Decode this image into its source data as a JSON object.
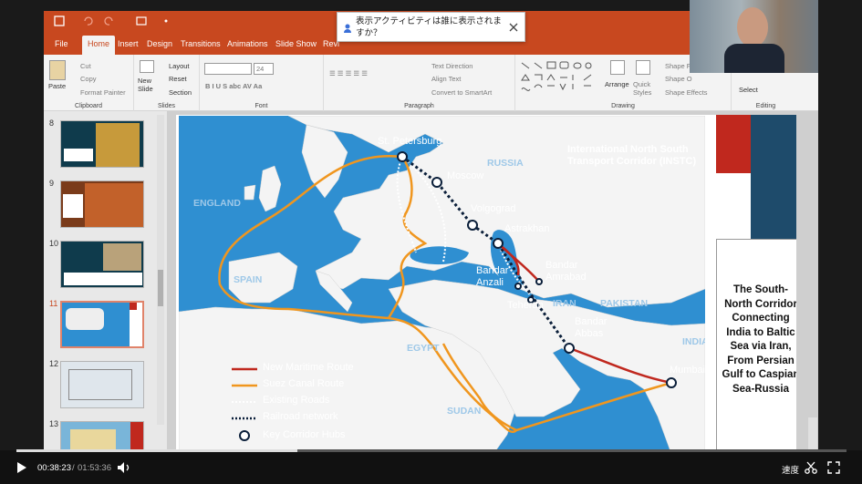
{
  "notification": {
    "text": "表示アクティビティは誰に表示されますか？"
  },
  "ribbon_tabs": [
    "File",
    "Home",
    "Insert",
    "Design",
    "Transitions",
    "Animations",
    "Slide Show",
    "Revi"
  ],
  "ribbon": {
    "clipboard": {
      "paste": "Paste",
      "cut": "Cut",
      "copy": "Copy",
      "format_painter": "Format Painter",
      "label": "Clipboard"
    },
    "slides": {
      "new_slide": "New Slide",
      "layout": "Layout",
      "reset": "Reset",
      "section": "Section",
      "label": "Slides"
    },
    "font": {
      "size": "24",
      "label": "Font"
    },
    "paragraph": {
      "text_direction": "Text Direction",
      "align_text": "Align Text",
      "convert_smartart": "Convert to SmartArt",
      "label": "Paragraph"
    },
    "drawing": {
      "arrange": "Arrange",
      "quick_styles": "Quick Styles",
      "shape_fill": "Shape F",
      "shape_outline": "Shape O",
      "shape_effects": "Shape Effects",
      "label": "Drawing"
    },
    "editing": {
      "select": "Select",
      "label": "Editing"
    }
  },
  "slides": [
    {
      "num": "8",
      "selected": false
    },
    {
      "num": "9",
      "selected": false
    },
    {
      "num": "10",
      "selected": false
    },
    {
      "num": "11",
      "selected": true
    },
    {
      "num": "12",
      "selected": false
    },
    {
      "num": "13",
      "selected": false
    }
  ],
  "map": {
    "title_line1": "International North South",
    "title_line2": "Transport Corridor (INSTC)",
    "cities": {
      "st_petersburg": "St. Petersburg",
      "moscow": "Moscow",
      "volgograd": "Volgograd",
      "astrakhan": "Astrakhan",
      "bandar_amrabad": "Bandar\nAmrabad",
      "bandar_anzali": "Bandar\nAnzali",
      "teheran": "Teheran",
      "bandar_abbas": "Bandar\nAbbas",
      "mumbai": "Mumbai"
    },
    "countries": {
      "russia": "RUSSIA",
      "england": "ENGLAND",
      "spain": "SPAIN",
      "egypt": "EGYPT",
      "sudan": "SUDAN",
      "iran": "IRAN",
      "pakistan": "PAKISTAN",
      "india": "INDIA"
    },
    "legend": {
      "maritime": "New Maritime Route",
      "suez": "Suez Canal Route",
      "roads": "Existing Roads",
      "rail": "Railroad network",
      "hubs": "Key Corridor Hubs"
    }
  },
  "sidebar_text": "The South-North Corridor Connecting India to Baltic Sea via Iran, From Persian Gulf to Caspian Sea-Russia",
  "player": {
    "current": "00:38:23",
    "separator": "/",
    "total": "01:53:36",
    "speed": "速度",
    "progress": 0.338
  },
  "colors": {
    "accent": "#c8481f",
    "maritime": "#c0281e",
    "suez": "#f0961e",
    "rail": "#0b1f3a",
    "sea": "#2f8fd1",
    "land": "#f4f4f4"
  }
}
